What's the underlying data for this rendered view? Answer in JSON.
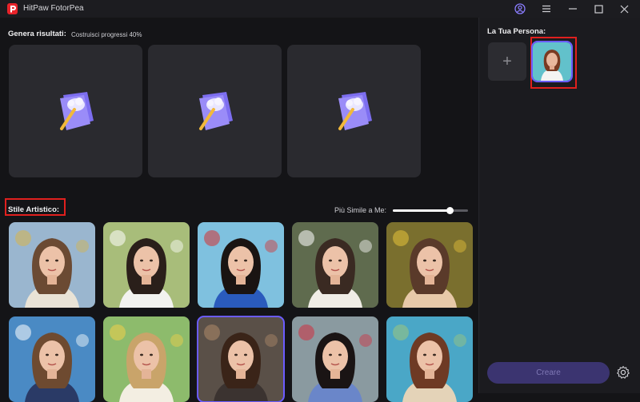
{
  "app": {
    "title": "HitPaw FotorPea"
  },
  "results": {
    "label": "Genera risultati:",
    "progress": "Costruisci progressi 40%"
  },
  "style": {
    "label": "Stile Artistico:",
    "similarity_label": "Più Simile a Me:",
    "similarity_value": 0.75
  },
  "persona": {
    "title": "La Tua Persona:",
    "add_symbol": "+"
  },
  "actions": {
    "create_label": "Creare"
  },
  "thumbnails": [
    {
      "name": "style-crown-princess",
      "bg": "#9ab6cf",
      "hair": "#6b4a33",
      "dress": "#e9e3d6",
      "accent": "#d8b44a"
    },
    {
      "name": "style-bridal-garden",
      "bg": "#a8bd7a",
      "hair": "#2a1f1a",
      "dress": "#f2f2ef",
      "accent": "#ffffff"
    },
    {
      "name": "style-snow-princess",
      "bg": "#7fc1df",
      "hair": "#1a1412",
      "dress": "#2a5bbd",
      "accent": "#d63030"
    },
    {
      "name": "style-bride-roses",
      "bg": "#5f6b4e",
      "hair": "#3a2a22",
      "dress": "#f0ede6",
      "accent": "#ffffff"
    },
    {
      "name": "style-flower-crown",
      "bg": "#7a6f2e",
      "hair": "#5a3a2a",
      "dress": "#e7c9a9",
      "accent": "#e6c23a"
    },
    {
      "name": "style-business-portrait",
      "bg": "#4a8ac4",
      "hair": "#6e4a30",
      "dress": "#2a3a66",
      "accent": "#ffffff"
    },
    {
      "name": "style-flower-field",
      "bg": "#8dbb6c",
      "hair": "#c9a46a",
      "dress": "#f3eee2",
      "accent": "#f2d04a"
    },
    {
      "name": "style-studio-portrait",
      "bg": "#5a5048",
      "hair": "#3a2418",
      "dress": "#3b3330",
      "accent": "#b08a6a"
    },
    {
      "name": "style-kimono",
      "bg": "#8a9aa0",
      "hair": "#1a1414",
      "dress": "#6a86c9",
      "accent": "#d03040"
    },
    {
      "name": "style-beach",
      "bg": "#4aa7c7",
      "hair": "#6e3a24",
      "dress": "#e4d3b8",
      "accent": "#9fc77a"
    }
  ],
  "colors": {
    "accent": "#6b5cff",
    "highlight": "#e0201e",
    "create_bg": "#3b3470"
  }
}
